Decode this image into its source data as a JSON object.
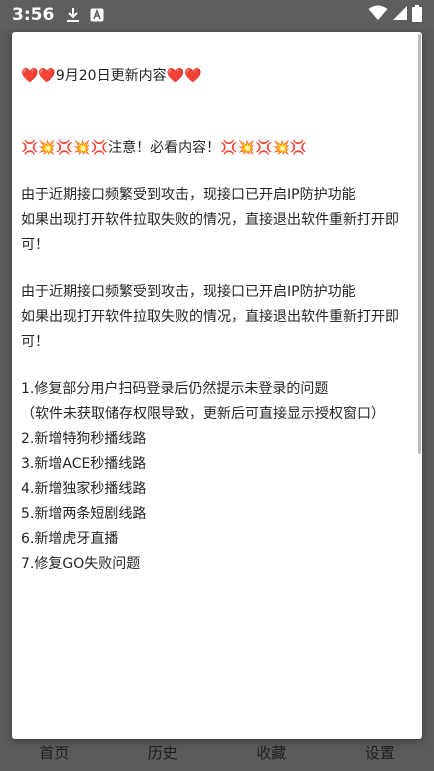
{
  "status_bar": {
    "time": "3:56",
    "download_icon": "download-icon",
    "app_notification_icon": "app-notification-icon",
    "wifi_icon": "wifi-icon",
    "signal_icon": "signal-icon",
    "battery_icon": "battery-icon"
  },
  "bottom_nav": {
    "items": [
      "首页",
      "历史",
      "收藏",
      "设置"
    ]
  },
  "dialog": {
    "title": "❤️❤️9月20日更新内容❤️❤️",
    "notice": "💢💥💢💥💢注意！必看内容！💢💥💢💥💢",
    "paragraph_1": [
      "由于近期接口频繁受到攻击，现接口已开启IP防护功能",
      "如果出现打开软件拉取失败的情况，直接退出软件重新打开即",
      "可！"
    ],
    "paragraph_2": [
      "由于近期接口频繁受到攻击，现接口已开启IP防护功能",
      "如果出现打开软件拉取失败的情况，直接退出软件重新打开即",
      "可！"
    ],
    "changelog": [
      "1.修复部分用户扫码登录后仍然提示未登录的问题",
      "（软件未获取储存权限导致，更新后可直接显示授权窗口）",
      "2.新增特狗秒播线路",
      "3.新增ACE秒播线路",
      "4.新增独家秒播线路",
      "5.新增两条短剧线路",
      "6.新增虎牙直播",
      "7.修复GO失败问题"
    ]
  }
}
